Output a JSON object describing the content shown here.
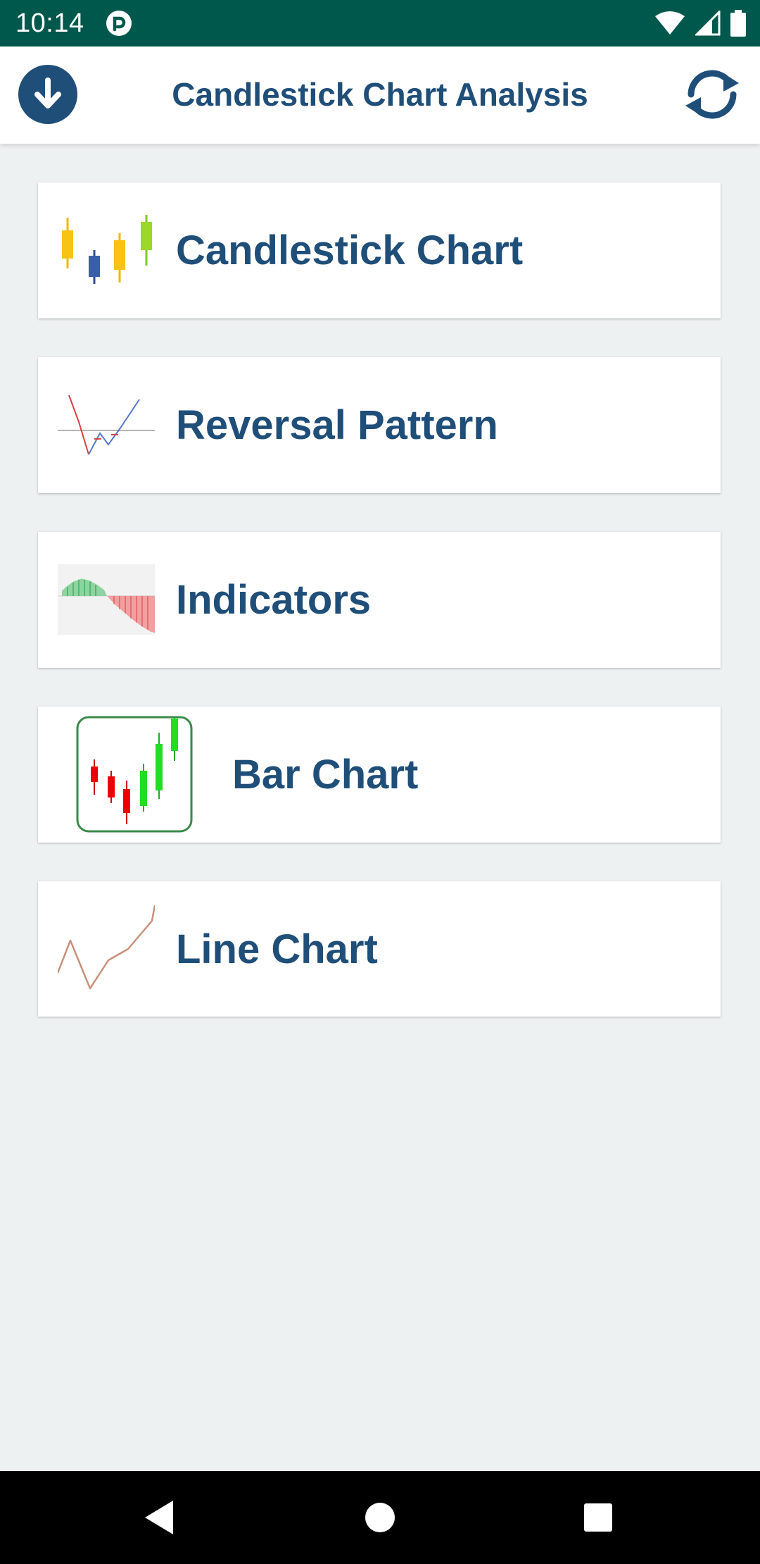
{
  "status_bar": {
    "time": "10:14",
    "icons": [
      "app-notification-icon",
      "wifi-icon",
      "signal-icon",
      "battery-icon"
    ]
  },
  "app_bar": {
    "title": "Candlestick Chart Analysis",
    "left_icon": "download-icon",
    "right_icon": "refresh-icon",
    "accent_color": "#1f4e79"
  },
  "menu": {
    "items": [
      {
        "label": "Candlestick Chart",
        "icon": "candlestick-chart-icon"
      },
      {
        "label": "Reversal Pattern",
        "icon": "reversal-pattern-icon"
      },
      {
        "label": "Indicators",
        "icon": "indicators-icon"
      },
      {
        "label": "Bar Chart",
        "icon": "bar-chart-icon"
      },
      {
        "label": "Line Chart",
        "icon": "line-chart-icon"
      }
    ]
  },
  "nav_bar": {
    "buttons": [
      "back-icon",
      "home-icon",
      "recents-icon"
    ]
  }
}
